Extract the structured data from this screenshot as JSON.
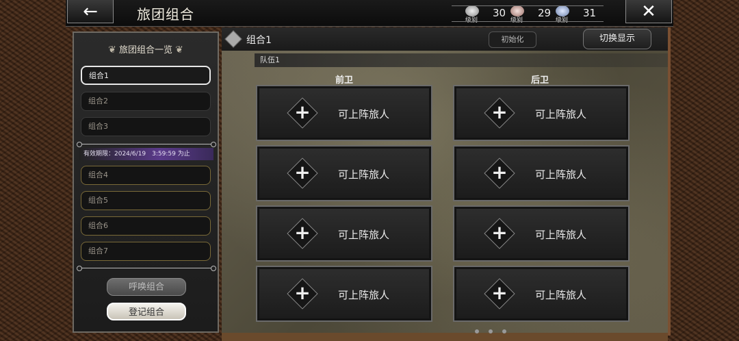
{
  "header": {
    "back_icon": "←",
    "title": "旅团组合",
    "close_icon": "✕",
    "currencies": [
      {
        "icon": "token-icon",
        "sub": "级别",
        "value": "30"
      },
      {
        "icon": "gem-red-icon",
        "sub": "级别",
        "value": "29"
      },
      {
        "icon": "gem-blue-icon",
        "sub": "级别",
        "value": "31"
      }
    ]
  },
  "sidebar": {
    "title": "旅团组合一览",
    "items": [
      {
        "label": "组合1"
      },
      {
        "label": "组合2"
      },
      {
        "label": "组合3"
      },
      {
        "label": "组合4"
      },
      {
        "label": "组合5"
      },
      {
        "label": "组合6"
      },
      {
        "label": "组合7"
      }
    ],
    "expiry": "有效期限：2024/6/19　3:59:59 为止",
    "summon_label": "呼唤组合",
    "register_label": "登记组合"
  },
  "main": {
    "title": "组合1",
    "init_label": "初始化",
    "switch_label": "切换显示",
    "team_label": "队伍1",
    "front_label": "前卫",
    "back_label": "后卫",
    "slot_label": "可上阵旅人",
    "slots": [
      {
        "label": "可上阵旅人"
      },
      {
        "label": "可上阵旅人"
      },
      {
        "label": "可上阵旅人"
      },
      {
        "label": "可上阵旅人"
      },
      {
        "label": "可上阵旅人"
      },
      {
        "label": "可上阵旅人"
      },
      {
        "label": "可上阵旅人"
      },
      {
        "label": "可上阵旅人"
      }
    ]
  }
}
